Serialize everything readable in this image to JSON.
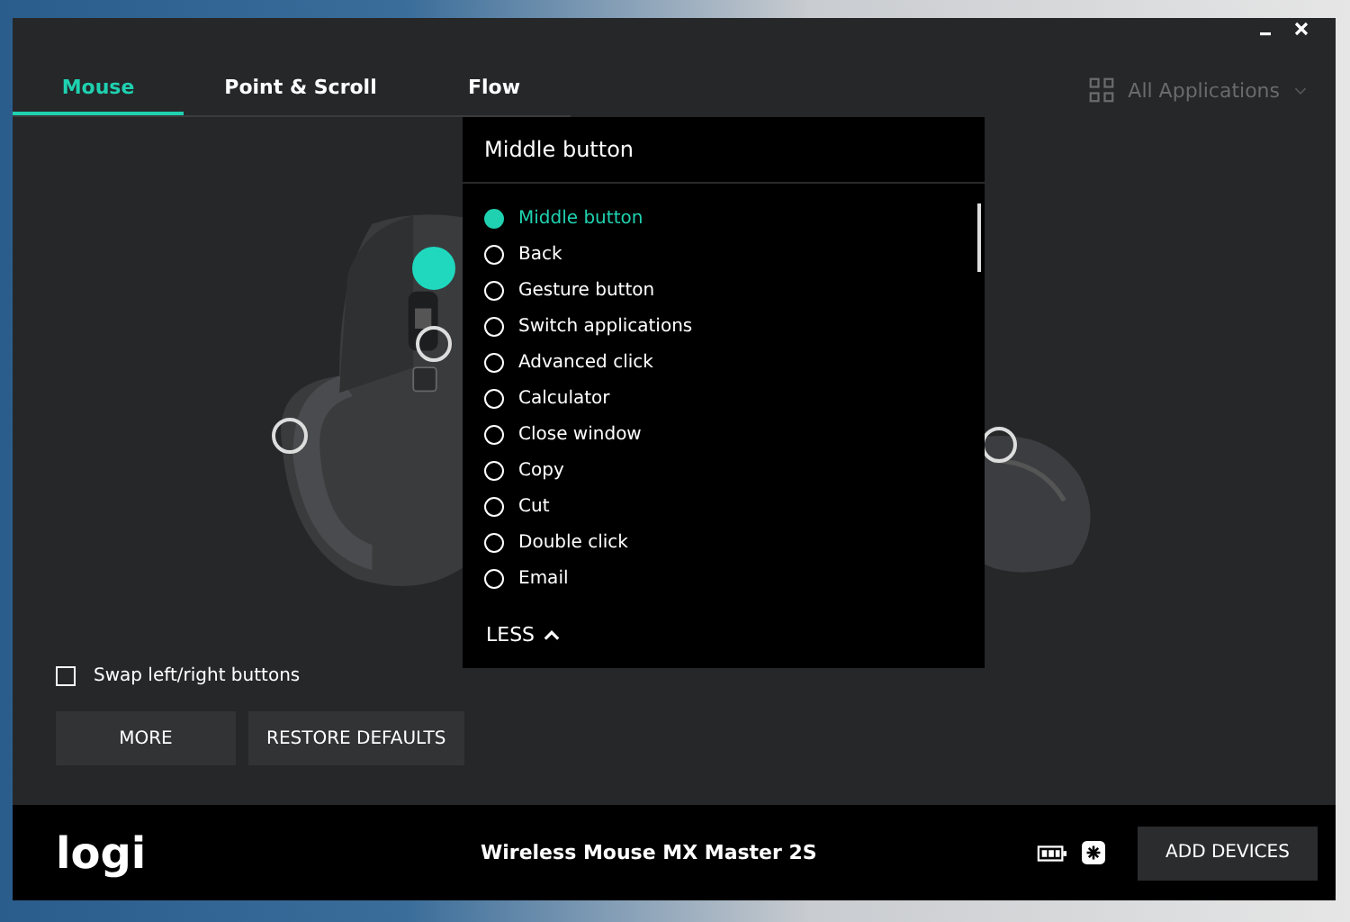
{
  "tabs": [
    {
      "label": "Mouse",
      "selected": true
    },
    {
      "label": "Point & Scroll",
      "selected": false
    },
    {
      "label": "Flow",
      "selected": false
    }
  ],
  "app_selector": {
    "label": "All Applications"
  },
  "hotspots": [
    {
      "selected": true
    },
    {
      "selected": false
    },
    {
      "selected": false
    },
    {
      "selected": false
    }
  ],
  "popup": {
    "title": "Middle button",
    "options": [
      {
        "label": "Middle button",
        "selected": true
      },
      {
        "label": "Back",
        "selected": false
      },
      {
        "label": "Gesture button",
        "selected": false
      },
      {
        "label": "Switch applications",
        "selected": false
      },
      {
        "label": "Advanced click",
        "selected": false
      },
      {
        "label": "Calculator",
        "selected": false
      },
      {
        "label": "Close window",
        "selected": false
      },
      {
        "label": "Copy",
        "selected": false
      },
      {
        "label": "Cut",
        "selected": false
      },
      {
        "label": "Double click",
        "selected": false
      },
      {
        "label": "Email",
        "selected": false
      }
    ],
    "less_button": "LESS"
  },
  "swap_checkbox": {
    "label": "Swap left/right buttons",
    "checked": false
  },
  "buttons": [
    "MORE",
    "RESTORE DEFAULTS"
  ],
  "footer": {
    "logo": "logi",
    "device": "Wireless Mouse MX Master 2S",
    "add_button": "ADD DEVICES"
  }
}
